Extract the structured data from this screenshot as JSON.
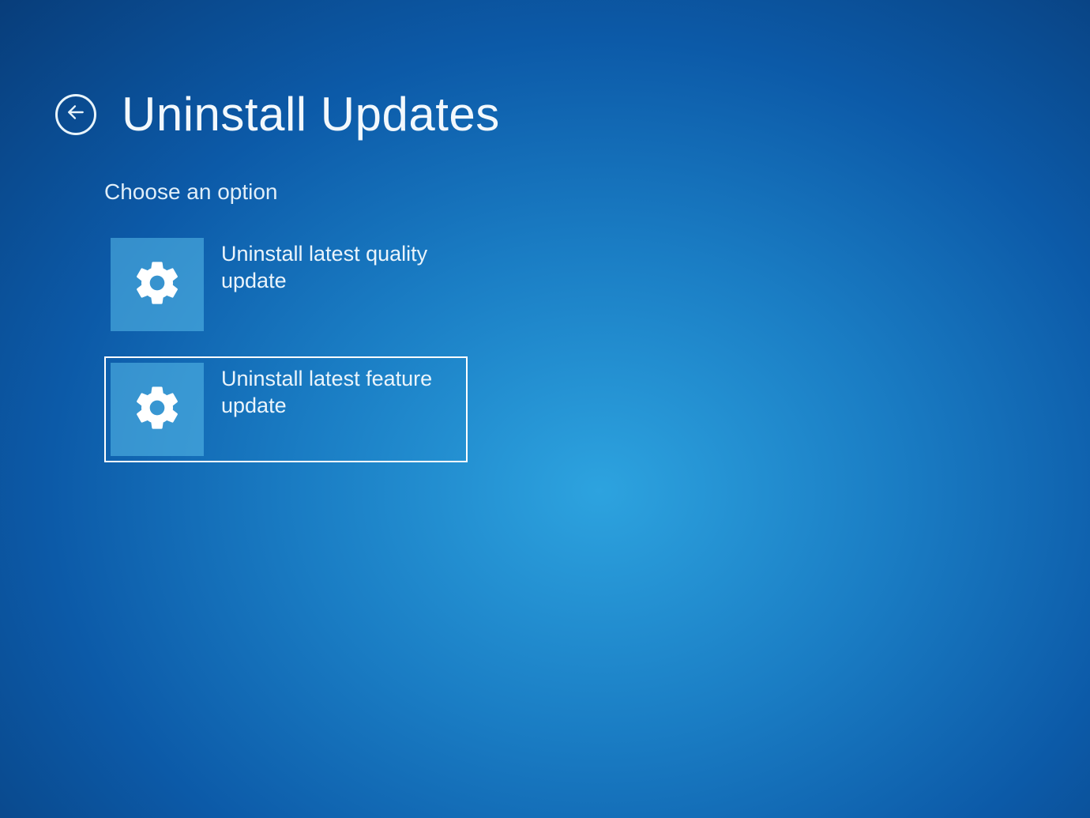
{
  "header": {
    "title": "Uninstall Updates"
  },
  "content": {
    "subtitle": "Choose an option"
  },
  "options": [
    {
      "label": "Uninstall latest quality update",
      "selected": false
    },
    {
      "label": "Uninstall latest feature update",
      "selected": true
    }
  ]
}
